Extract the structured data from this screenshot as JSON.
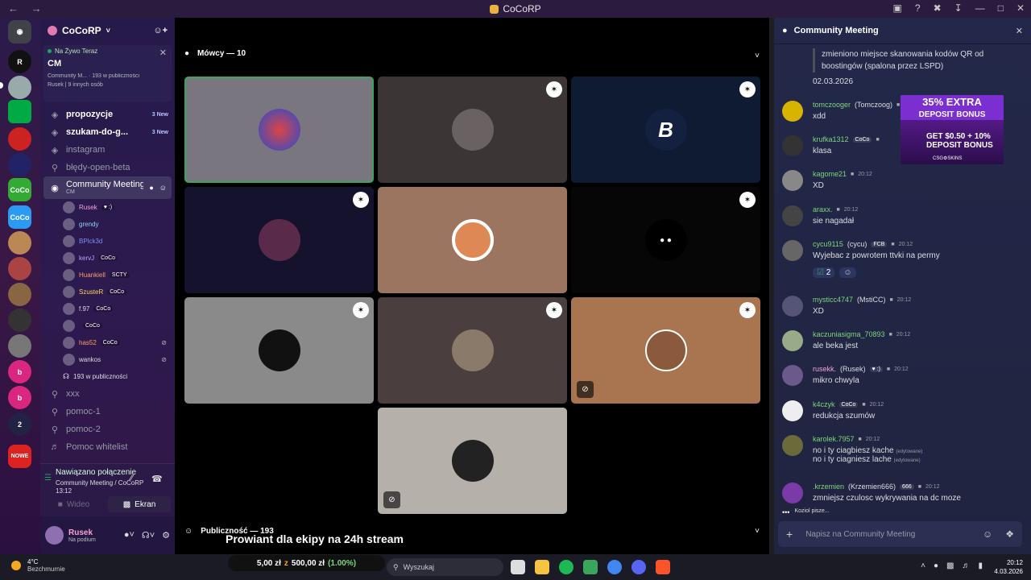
{
  "app": {
    "title": "CoCoRP"
  },
  "server": {
    "name": "CoCoRP"
  },
  "live": {
    "label": "Na Żywo Teraz",
    "title": "CM",
    "channel_line": "Community M...",
    "audience_line": "193 w publiczności",
    "users_line": "Rusek | 9 innych osób"
  },
  "channels": [
    {
      "name": "propozycje",
      "badge": "3 New",
      "icon": "forum-icon"
    },
    {
      "name": "szukam-do-g...",
      "badge": "3 New",
      "icon": "forum-icon"
    },
    {
      "name": "instagram",
      "badge": "",
      "icon": "forum-icon"
    },
    {
      "name": "błędy-open-beta",
      "badge": "",
      "icon": "lock-icon"
    }
  ],
  "active_channel": {
    "name": "Community Meeting",
    "sub": "CM"
  },
  "voice_users": [
    {
      "name": "Rusek",
      "tag": "♥ :)",
      "color": "#f4a3d8"
    },
    {
      "name": "grendy",
      "tag": "",
      "color": "#8fd3ff"
    },
    {
      "name": "BPlck3d",
      "tag": "",
      "color": "#7b8cff"
    },
    {
      "name": "kervJ",
      "tag": "CoCo",
      "color": "#b9a3ff"
    },
    {
      "name": "Huankiell",
      "tag": "SCTY",
      "color": "#ff9c6b"
    },
    {
      "name": "SzusteR",
      "tag": "CoCo",
      "color": "#ffd36b"
    },
    {
      "name": "f.97",
      "tag": "CoCo",
      "color": "#dbdee1"
    },
    {
      "name": "",
      "tag": "CoCo",
      "color": "#dbdee1"
    },
    {
      "name": "has52",
      "tag": "CoCo",
      "color": "#ff9c6b"
    },
    {
      "name": "wankos",
      "tag": "",
      "color": "#dbdee1"
    }
  ],
  "audience_row": "193 w publiczności",
  "channels2": [
    {
      "name": "xxx",
      "icon": "lock-icon"
    },
    {
      "name": "pomoc-1",
      "icon": "lock-icon"
    },
    {
      "name": "pomoc-2",
      "icon": "lock-icon"
    },
    {
      "name": "Pomoc whitelist",
      "icon": "voice-icon"
    }
  ],
  "voice_status": {
    "title": "Nawiązano połączenie",
    "location": "Community Meeting / CoCoRP",
    "time": "13:12",
    "video_label": "Wideo",
    "screen_label": "Ekran"
  },
  "user": {
    "name": "Rusek",
    "status": "Na podium"
  },
  "stage": {
    "speakers_label": "Mówcy — 10",
    "audience_label": "Publiczność — 193"
  },
  "overlay_text": "Prowiant dla ekipy na 24h stream",
  "chat": {
    "title": "Community Meeting",
    "quote": "zmieniono miejsce skanowania kodów QR od boostingów (spalona przez LSPD)",
    "date": "02.03.2026",
    "messages": [
      {
        "name": "tomczooger",
        "extra": "(Tomczoog)",
        "tag": "",
        "time": "",
        "text": "xdd",
        "color": "#7cd67c"
      },
      {
        "name": "krufka1312",
        "extra": "",
        "tag": "CoCo",
        "time": "",
        "text": "klasa",
        "color": "#7cd67c"
      },
      {
        "name": "kagome21",
        "extra": "",
        "tag": "",
        "time": "20:12",
        "text": "XD",
        "color": "#7cd67c"
      },
      {
        "name": "araxx.",
        "extra": "",
        "tag": "",
        "time": "20:12",
        "text": "sie nagadał",
        "color": "#7cd67c"
      },
      {
        "name": "cycu9115",
        "extra": "(cycu)",
        "tag": "FCB",
        "time": "20:12",
        "text": "Wyjebac z powrotem ttvki na permy",
        "color": "#7cd67c"
      },
      {
        "name": "mysticc4747",
        "extra": "(MstiCC)",
        "tag": "",
        "time": "20:12",
        "text": "XD",
        "color": "#7cd67c"
      },
      {
        "name": "kaczuniasigma_70893",
        "extra": "",
        "tag": "",
        "time": "20:12",
        "text": "ale beka jest",
        "color": "#7cd67c"
      },
      {
        "name": "rusekk.",
        "extra": "(Rusek)",
        "tag": "♥ :)",
        "time": "20:12",
        "text": "mikro chwyla",
        "color": "#f4a3d8"
      },
      {
        "name": "k4czyk",
        "extra": "",
        "tag": "CoCo",
        "time": "20:12",
        "text": "redukcja szumów",
        "color": "#7cd67c"
      },
      {
        "name": "karolek.7957",
        "extra": "",
        "tag": "",
        "time": "20:12",
        "text": "no i ty ciagbiesz kache",
        "text2": "no i ty ciagniesz lache",
        "color": "#7cd67c"
      },
      {
        "name": ".krzemien",
        "extra": "(Krzemien666)",
        "tag": "666",
        "time": "20:12",
        "text": "zmniejsz czulosc wykrywania na dc moze",
        "color": "#7cd67c"
      }
    ],
    "reaction_count": "2",
    "edited": "(edytowane)",
    "typing": "Koziol pisze...",
    "input_placeholder": "Napisz na Community Meeting"
  },
  "ad": {
    "line1": "35% EXTRA",
    "line2": "DEPOSIT BONUS",
    "line3": "GET $0.50 + 10%",
    "line4": "DEPOSIT BONUS",
    "brand": "CSG⚙SKINS"
  },
  "taskbar": {
    "temp": "4°C",
    "weather": "Bezchmurnie",
    "progress_text": "5,00 zł",
    "progress_of": "z",
    "progress_goal": "500,00 zł",
    "progress_pct": "(1.00%)",
    "search": "Wyszukaj",
    "time": "20:12",
    "date": "4.03.2026"
  },
  "colors": {
    "accent": "#5865f2",
    "green": "#23a55a"
  }
}
